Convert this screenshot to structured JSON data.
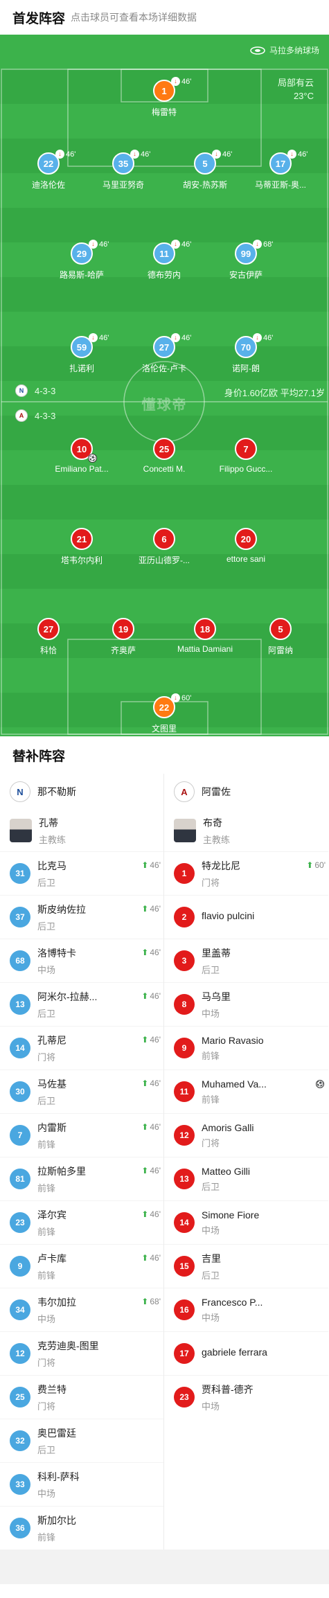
{
  "header": {
    "title": "首发阵容",
    "subtitle": "点击球员可查看本场详细数据"
  },
  "pitch": {
    "venue": "马拉多纳球场",
    "weather": "局部有云",
    "temperature": "23°C",
    "watermark": "懂球帝",
    "home_formation": "4-3-3",
    "away_formation": "4-3-3",
    "team_value": "身价1.60亿欧",
    "avg_age": "平均27.1岁"
  },
  "home_players": [
    {
      "number": "1",
      "name": "梅雷特",
      "sub": "46'",
      "kind": "gk"
    },
    {
      "number": "22",
      "name": "迪洛伦佐",
      "sub": "46'"
    },
    {
      "number": "35",
      "name": "马里亚努奇",
      "sub": "46'"
    },
    {
      "number": "5",
      "name": "胡安-热苏斯",
      "sub": "46'"
    },
    {
      "number": "17",
      "name": "马蒂亚斯-奥...",
      "sub": "46'"
    },
    {
      "number": "29",
      "name": "路易斯-哈萨",
      "sub": "46'"
    },
    {
      "number": "11",
      "name": "德布劳内",
      "sub": "46'"
    },
    {
      "number": "99",
      "name": "安古伊萨",
      "sub": "68'"
    },
    {
      "number": "59",
      "name": "扎诺利",
      "sub": "46'"
    },
    {
      "number": "27",
      "name": "洛伦佐-卢卡",
      "sub": "46'"
    },
    {
      "number": "70",
      "name": "诺阿-朗",
      "sub": "46'"
    }
  ],
  "away_players": [
    {
      "number": "10",
      "name": "Emiliano Pat...",
      "goal": true
    },
    {
      "number": "25",
      "name": "Concetti M."
    },
    {
      "number": "7",
      "name": "Filippo Gucc..."
    },
    {
      "number": "21",
      "name": "塔韦尔内利"
    },
    {
      "number": "6",
      "name": "亚历山德罗-..."
    },
    {
      "number": "20",
      "name": "ettore sani"
    },
    {
      "number": "27",
      "name": "科恰"
    },
    {
      "number": "19",
      "name": "齐奥萨"
    },
    {
      "number": "18",
      "name": "Mattia Damiani"
    },
    {
      "number": "5",
      "name": "阿雷纳"
    },
    {
      "number": "22",
      "name": "文图里",
      "sub": "60'",
      "kind": "gk"
    }
  ],
  "subs": {
    "title": "替补阵容",
    "home": {
      "team": "那不勒斯",
      "coach_name": "孔蒂",
      "coach_role": "主教练",
      "players": [
        {
          "number": "31",
          "name": "比克马",
          "pos": "后卫",
          "on": "46'"
        },
        {
          "number": "37",
          "name": "斯皮纳佐拉",
          "pos": "后卫",
          "on": "46'"
        },
        {
          "number": "68",
          "name": "洛博特卡",
          "pos": "中场",
          "on": "46'"
        },
        {
          "number": "13",
          "name": "阿米尔-拉赫...",
          "pos": "后卫",
          "on": "46'"
        },
        {
          "number": "14",
          "name": "孔蒂尼",
          "pos": "门将",
          "on": "46'"
        },
        {
          "number": "30",
          "name": "马佐基",
          "pos": "后卫",
          "on": "46'"
        },
        {
          "number": "7",
          "name": "内雷斯",
          "pos": "前锋",
          "on": "46'"
        },
        {
          "number": "81",
          "name": "拉斯帕多里",
          "pos": "前锋",
          "on": "46'"
        },
        {
          "number": "23",
          "name": "泽尔宾",
          "pos": "前锋",
          "on": "46'"
        },
        {
          "number": "9",
          "name": "卢卡库",
          "pos": "前锋",
          "on": "46'"
        },
        {
          "number": "34",
          "name": "韦尔加拉",
          "pos": "中场",
          "on": "68'"
        },
        {
          "number": "12",
          "name": "克劳迪奥-图里",
          "pos": "门将"
        },
        {
          "number": "25",
          "name": "费兰特",
          "pos": "门将"
        },
        {
          "number": "32",
          "name": "奥巴雷廷",
          "pos": "后卫"
        },
        {
          "number": "33",
          "name": "科利-萨科",
          "pos": "中场"
        },
        {
          "number": "36",
          "name": "斯加尔比",
          "pos": "前锋"
        }
      ]
    },
    "away": {
      "team": "阿雷佐",
      "coach_name": "布奇",
      "coach_role": "主教练",
      "players": [
        {
          "number": "1",
          "name": "特龙比尼",
          "pos": "门将",
          "on": "60'"
        },
        {
          "number": "2",
          "name": "flavio pulcini",
          "pos": ""
        },
        {
          "number": "3",
          "name": "里盖蒂",
          "pos": "后卫"
        },
        {
          "number": "8",
          "name": "马乌里",
          "pos": "中场"
        },
        {
          "number": "9",
          "name": "Mario Ravasio",
          "pos": "前锋"
        },
        {
          "number": "11",
          "name": "Muhamed Va...",
          "pos": "前锋",
          "goal": true
        },
        {
          "number": "12",
          "name": "Amoris Galli",
          "pos": "门将"
        },
        {
          "number": "13",
          "name": "Matteo Gilli",
          "pos": "后卫"
        },
        {
          "number": "14",
          "name": "Simone Fiore",
          "pos": "中场"
        },
        {
          "number": "15",
          "name": "吉里",
          "pos": "后卫"
        },
        {
          "number": "16",
          "name": "Francesco P...",
          "pos": "中场"
        },
        {
          "number": "17",
          "name": "gabriele ferrara",
          "pos": ""
        },
        {
          "number": "23",
          "name": "贾科普-德齐",
          "pos": "中场"
        }
      ]
    }
  },
  "colors": {
    "pitch": "#3cb24b",
    "home": "#58b1ea",
    "away": "#e21b1b",
    "gk": "#ff7a12"
  }
}
